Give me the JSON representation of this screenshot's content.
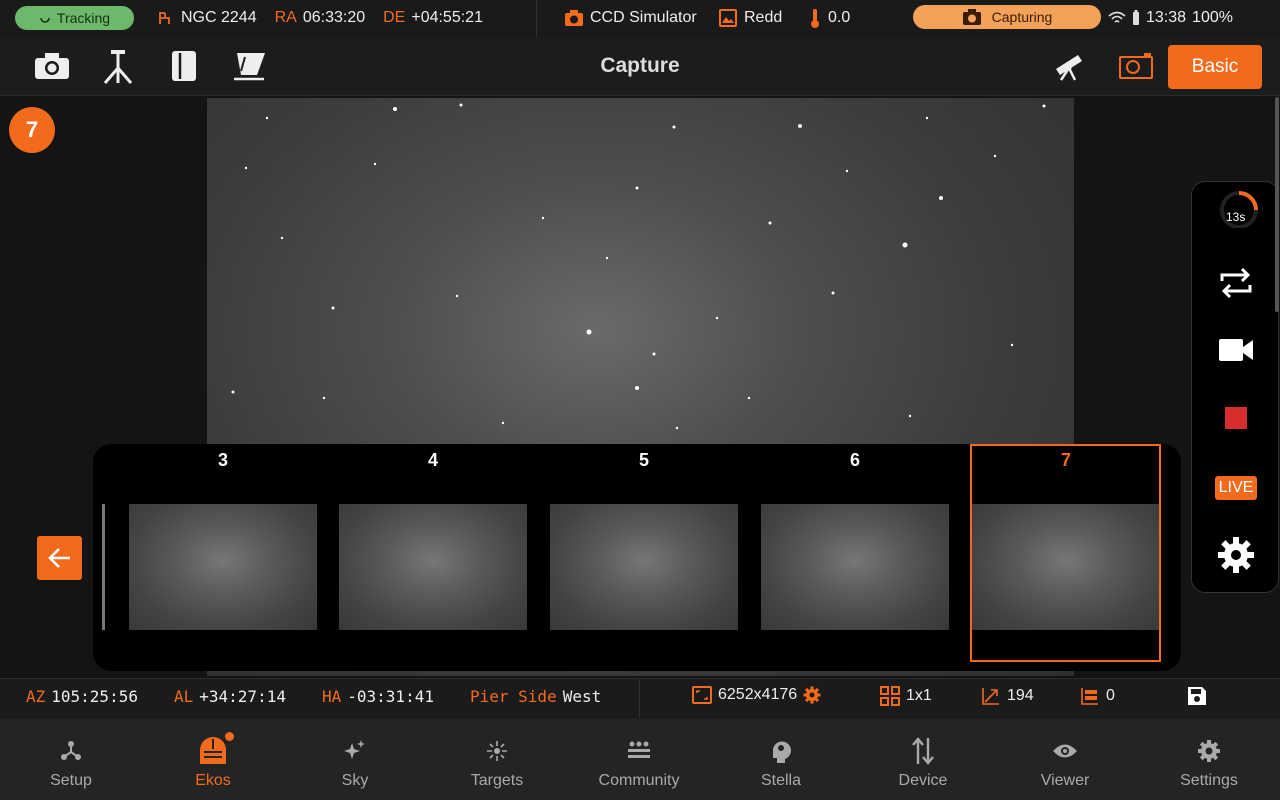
{
  "status": {
    "tracking": "Tracking",
    "target": "NGC 2244",
    "ra_label": "RA",
    "ra_value": "06:33:20",
    "de_label": "DE",
    "de_value": "+04:55:21",
    "camera": "CCD Simulator",
    "filter": "Redd",
    "temperature": "0.0",
    "capturing": "Capturing",
    "time": "13:38",
    "battery": "100%"
  },
  "toolbar": {
    "title": "Capture",
    "mode_button": "Basic"
  },
  "viewer": {
    "frame_badge": "7"
  },
  "filmstrip": {
    "frames": [
      "3",
      "4",
      "5",
      "6",
      "7"
    ],
    "selected": "7"
  },
  "side_panel": {
    "countdown": "13s",
    "countdown_fraction": 0.25,
    "live": "LIVE"
  },
  "info": {
    "az_label": "AZ",
    "az_value": "105:25:56",
    "al_label": "AL",
    "al_value": "+34:27:14",
    "ha_label": "HA",
    "ha_value": "-03:31:41",
    "pier_label": "Pier Side",
    "pier_value": "West",
    "resolution": "6252x4176",
    "binning": "1x1",
    "gain": "194",
    "offset": "0"
  },
  "nav": {
    "items": [
      {
        "label": "Setup",
        "icon": "setup-icon"
      },
      {
        "label": "Ekos",
        "icon": "ekos-icon"
      },
      {
        "label": "Sky",
        "icon": "sky-icon"
      },
      {
        "label": "Targets",
        "icon": "targets-icon"
      },
      {
        "label": "Community",
        "icon": "community-icon"
      },
      {
        "label": "Stella",
        "icon": "stella-icon"
      },
      {
        "label": "Device",
        "icon": "device-icon"
      },
      {
        "label": "Viewer",
        "icon": "viewer-icon"
      },
      {
        "label": "Settings",
        "icon": "settings-icon"
      }
    ],
    "active": "Ekos"
  },
  "colors": {
    "accent": "#f26b1d",
    "tracking": "#6db86a",
    "capturing": "#f4a259",
    "stop": "#d62d2d"
  }
}
